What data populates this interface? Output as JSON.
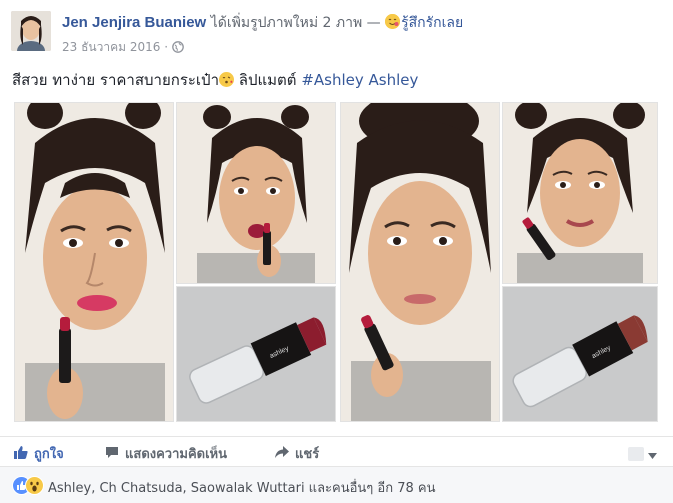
{
  "post": {
    "author": "Jen Jenjira Buaniew",
    "action": "ได้เพิ่มรูปภาพใหม่ 2 ภาพ —",
    "feeling": "รู้สึกรักเลย",
    "timestamp": "23 ธันวาคม 2016",
    "separator": "·",
    "caption": "สีสวย ทาง่าย ราคาสบายกระเป๋า",
    "caption_rest": "ลิปแมตต์",
    "hashtag": "#Ashley",
    "caption_tail": "Ashley"
  },
  "actions": {
    "like": "ถูกใจ",
    "comment": "แสดงความคิดเห็น",
    "share": "แชร์"
  },
  "reactions": {
    "text": "Ashley, Ch Chatsuda, Saowalak Wuttari และคนอื่นๆ อีก 78 คน"
  },
  "icons": [
    "globe-icon",
    "like-icon",
    "comment-icon",
    "share-icon",
    "wow-reaction-icon",
    "like-reaction-icon",
    "chevron-down-icon"
  ],
  "colors": {
    "link": "#365899",
    "like_accent": "#4267b2",
    "lipstick": "#8c1d2e"
  }
}
